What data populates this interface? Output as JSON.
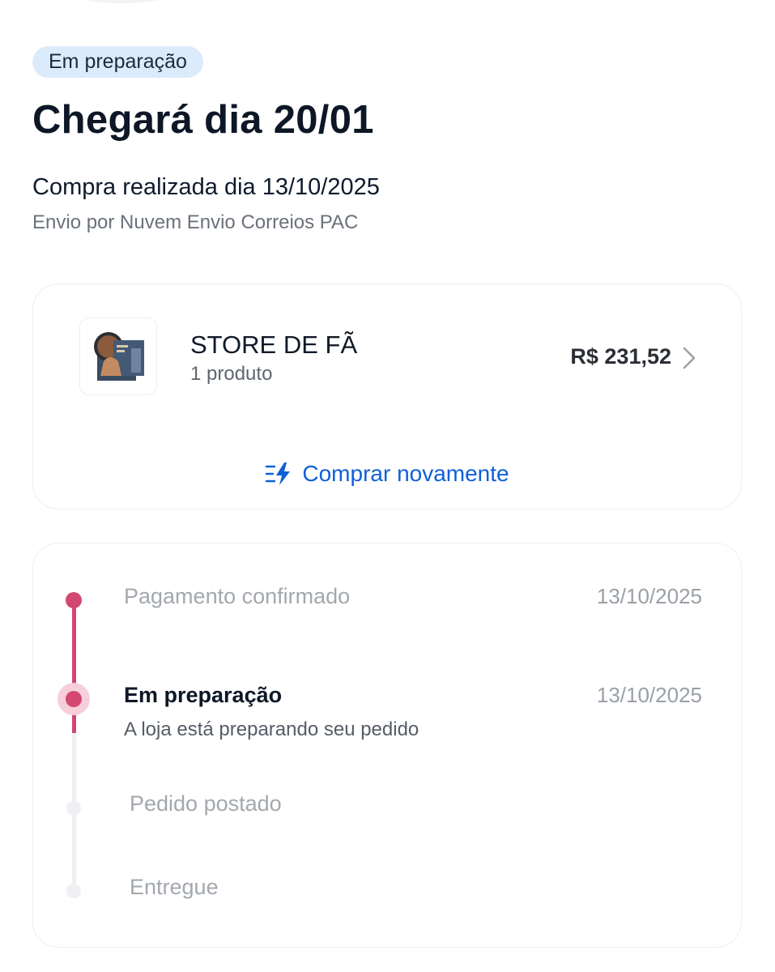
{
  "header": {
    "status_badge": "Em preparação",
    "arrival": "Chegará dia 20/01",
    "purchase_date": "Compra realizada dia 13/10/2025",
    "shipping": "Envio por Nuvem Envio Correios PAC"
  },
  "order": {
    "store_name": "STORE DE FÃ",
    "product_count": "1 produto",
    "total": "R$ 231,52",
    "buy_again_label": "Comprar novamente",
    "buy_again_icon": "flash-icon",
    "chevron_icon": "chevron-right-icon"
  },
  "timeline": {
    "steps": [
      {
        "label": "Pagamento confirmado",
        "date": "13/10/2025",
        "state": "done"
      },
      {
        "label": "Em preparação",
        "date": "13/10/2025",
        "description": "A loja está preparando seu pedido",
        "state": "current"
      },
      {
        "label": "Pedido postado",
        "state": "pending"
      },
      {
        "label": "Entregue",
        "state": "pending"
      }
    ]
  },
  "colors": {
    "accent": "#d34870",
    "link": "#0f5fd7",
    "badge_bg": "#dcebfb"
  }
}
